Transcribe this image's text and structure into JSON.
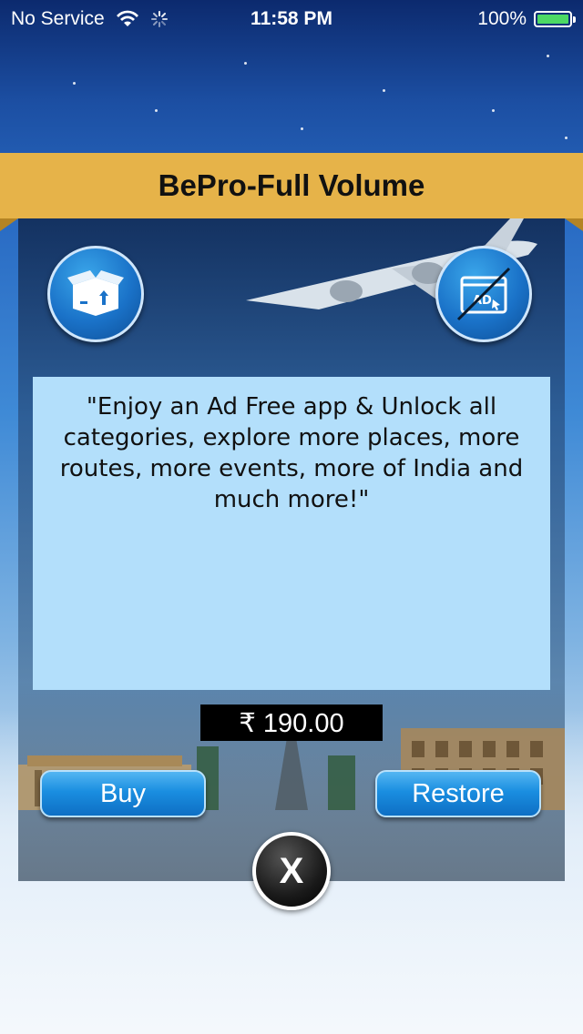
{
  "status_bar": {
    "carrier": "No Service",
    "time": "11:58 PM",
    "battery": "100%"
  },
  "header": {
    "title": "BePro-Full Volume"
  },
  "promo": {
    "description": "\"Enjoy an Ad Free app & Unlock all categories, explore more places, more routes, more events, more of India and much more!\"",
    "price": "₹ 190.00"
  },
  "actions": {
    "buy_label": "Buy",
    "restore_label": "Restore",
    "close_label": "X"
  },
  "icons": {
    "unlock": "open-box-icon",
    "no_ads": "no-ads-icon"
  },
  "colors": {
    "title_bar": "#e6b349",
    "description_bg": "#b3dffb",
    "button_blue": "#1a8ee0",
    "battery_green": "#4cd964"
  }
}
